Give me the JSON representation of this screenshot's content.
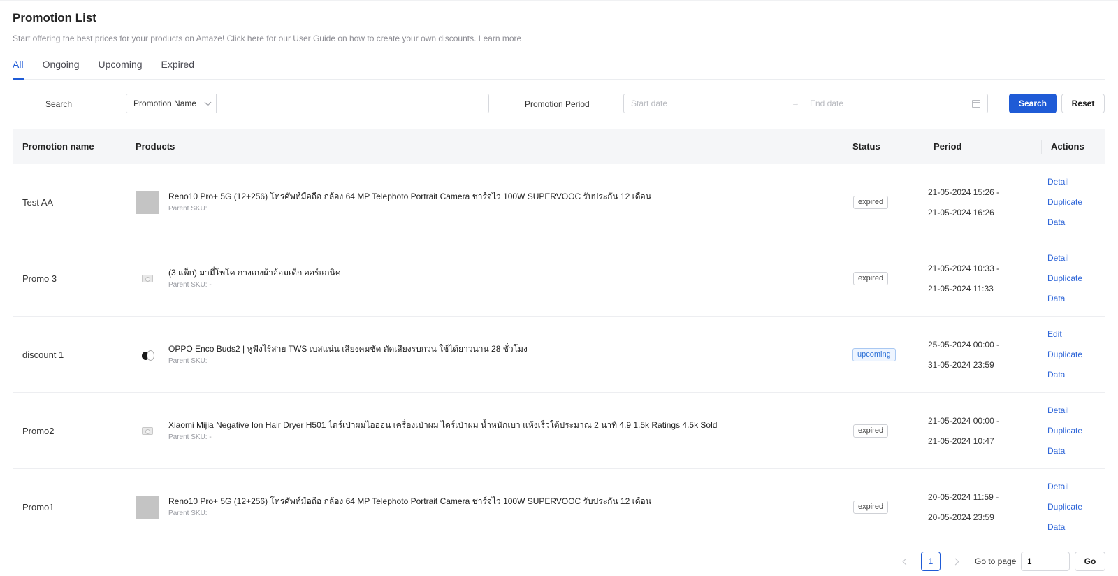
{
  "header": {
    "title": "Promotion List",
    "subtitle": "Start offering the best prices for your products on Amaze! Click here for our User Guide on how to create your own discounts.",
    "learn_more": "Learn more"
  },
  "tabs": [
    {
      "label": "All",
      "active": true
    },
    {
      "label": "Ongoing",
      "active": false
    },
    {
      "label": "Upcoming",
      "active": false
    },
    {
      "label": "Expired",
      "active": false
    }
  ],
  "filters": {
    "search_label": "Search",
    "search_select_value": "Promotion Name",
    "search_input_value": "",
    "period_label": "Promotion Period",
    "start_placeholder": "Start date",
    "range_arrow": "→",
    "end_placeholder": "End date",
    "search_button": "Search",
    "reset_button": "Reset"
  },
  "table": {
    "columns": [
      "Promotion name",
      "Products",
      "Status",
      "Period",
      "Actions"
    ],
    "rows": [
      {
        "name": "Test AA",
        "product_title": "Reno10 Pro+ 5G (12+256) โทรศัพท์มือถือ กล้อง 64 MP Telephoto Portrait Camera ชาร์จไว 100W SUPERVOOC รับประกัน 12 เดือน",
        "product_sku": "Parent SKU:",
        "thumb": "gray",
        "status": "expired",
        "period_start": "21-05-2024 15:26 -",
        "period_end": "21-05-2024 16:26",
        "actions": [
          "Detail",
          "Duplicate",
          "Data"
        ]
      },
      {
        "name": "Promo 3",
        "product_title": "(3 แพ็ก) มามี่โพโค กางเกงผ้าอ้อมเด็ก ออร์แกนิค",
        "product_sku": "Parent SKU: -",
        "thumb": "camera-placeholder",
        "status": "expired",
        "period_start": "21-05-2024 10:33 -",
        "period_end": "21-05-2024 11:33",
        "actions": [
          "Detail",
          "Duplicate",
          "Data"
        ]
      },
      {
        "name": "discount 1",
        "product_title": "OPPO Enco Buds2 | หูฟังไร้สาย TWS เบสแน่น เสียงคมชัด ตัดเสียงรบกวน ใช้ได้ยาวนาน 28 ชั่วโมง",
        "product_sku": "Parent SKU:",
        "thumb": "earbuds",
        "status": "upcoming",
        "period_start": "25-05-2024 00:00 -",
        "period_end": "31-05-2024 23:59",
        "actions": [
          "Edit",
          "Duplicate",
          "Data"
        ]
      },
      {
        "name": "Promo2",
        "product_title": "Xiaomi Mijia Negative Ion Hair Dryer H501 ไดร์เป่าผมไอออน เครื่องเป่าผม ไดร์เป่าผม น้ำหนักเบา แห้งเร็วใต้ประมาณ 2 นาที 4.9 1.5k Ratings 4.5k Sold",
        "product_sku": "Parent SKU: -",
        "thumb": "camera-placeholder",
        "status": "expired",
        "period_start": "21-05-2024 00:00 -",
        "period_end": "21-05-2024 10:47",
        "actions": [
          "Detail",
          "Duplicate",
          "Data"
        ]
      },
      {
        "name": "Promo1",
        "product_title": "Reno10 Pro+ 5G (12+256) โทรศัพท์มือถือ กล้อง 64 MP Telephoto Portrait Camera ชาร์จไว 100W SUPERVOOC รับประกัน 12 เดือน",
        "product_sku": "Parent SKU:",
        "thumb": "gray",
        "status": "expired",
        "period_start": "20-05-2024 11:59 -",
        "period_end": "20-05-2024 23:59",
        "actions": [
          "Detail",
          "Duplicate",
          "Data"
        ]
      }
    ]
  },
  "pagination": {
    "current_page": "1",
    "goto_label": "Go to page",
    "goto_value": "1",
    "go_button": "Go"
  },
  "colors": {
    "accent": "#1f5bd6",
    "link": "#2f66d8",
    "header_bg": "#f5f6f8"
  }
}
